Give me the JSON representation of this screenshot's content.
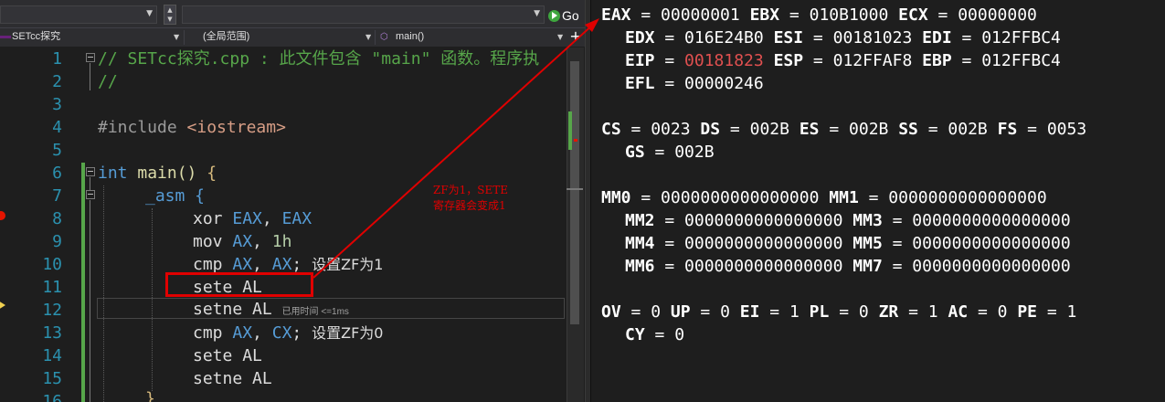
{
  "toolbar": {
    "go_label": "Go"
  },
  "navbar": {
    "file": "SETcc探究",
    "scope": "(全局范围)",
    "func": "main()",
    "plus": "+"
  },
  "code": {
    "line_numbers": [
      "1",
      "2",
      "3",
      "4",
      "5",
      "6",
      "7",
      "8",
      "9",
      "10",
      "11",
      "12",
      "13",
      "14",
      "15",
      "16"
    ],
    "l1": "// SETcc探究.cpp : 此文件包含 \"main\" 函数。程序执",
    "l2": "//",
    "l4a": "#include ",
    "l4b": "<iostream>",
    "l6a": "int",
    "l6b": " main() ",
    "l6c": "{",
    "l7": "_asm {",
    "l8a": "xor ",
    "l8b": "EAX",
    "l8c": ", ",
    "l8d": "EAX",
    "l9a": "mov ",
    "l9b": "AX",
    "l9c": ", ",
    "l9d": "1h",
    "l10a": "cmp ",
    "l10b": "AX",
    "l10c": ", ",
    "l10d": "AX",
    "l10e": "; ",
    "l10f": "设置ZF为1",
    "l11a": "sete ",
    "l11b": "AL",
    "l12a": "setne ",
    "l12b": "AL",
    "l12c": "已用时间 <=1ms",
    "l13a": "cmp ",
    "l13b": "AX",
    "l13c": ", ",
    "l13d": "CX",
    "l13e": "; ",
    "l13f": "设置ZF为0",
    "l14a": "sete ",
    "l14b": "AL",
    "l15a": "setne ",
    "l15b": "AL",
    "l16": "}"
  },
  "annotation": {
    "line1": "ZF为1，SETE",
    "line2": "寄存器会变成1"
  },
  "registers": {
    "r1": {
      "a": "EAX",
      "av": "00000001",
      "b": "EBX",
      "bv": "010B1000",
      "c": "ECX",
      "cv": "00000000"
    },
    "r2": {
      "a": "EDX",
      "av": "016E24B0",
      "b": "ESI",
      "bv": "00181023",
      "c": "EDI",
      "cv": "012FFBC4"
    },
    "r3": {
      "a": "EIP",
      "av": "00181823",
      "b": "ESP",
      "bv": "012FFAF8",
      "c": "EBP",
      "cv": "012FFBC4"
    },
    "r4": {
      "a": "EFL",
      "av": "00000246"
    },
    "seg1": {
      "a": "CS",
      "av": "0023",
      "b": "DS",
      "bv": "002B",
      "c": "ES",
      "cv": "002B",
      "d": "SS",
      "dv": "002B",
      "e": "FS",
      "ev": "0053"
    },
    "seg2": {
      "a": "GS",
      "av": "002B"
    },
    "mm1": {
      "a": "MM0",
      "av": "0000000000000000",
      "b": "MM1",
      "bv": "0000000000000000"
    },
    "mm2": {
      "a": "MM2",
      "av": "0000000000000000",
      "b": "MM3",
      "bv": "0000000000000000"
    },
    "mm3": {
      "a": "MM4",
      "av": "0000000000000000",
      "b": "MM5",
      "bv": "0000000000000000"
    },
    "mm4": {
      "a": "MM6",
      "av": "0000000000000000",
      "b": "MM7",
      "bv": "0000000000000000"
    },
    "fl1": {
      "a": "OV",
      "av": "0",
      "b": "UP",
      "bv": "0",
      "c": "EI",
      "cv": "1",
      "d": "PL",
      "dv": "0",
      "e": "ZR",
      "ev": "1",
      "f": "AC",
      "fv": "0",
      "g": "PE",
      "gv": "1"
    },
    "fl2": {
      "a": "CY",
      "av": "0"
    }
  },
  "colors": {
    "annotation": "#e00000",
    "changed_value": "#e05050"
  }
}
